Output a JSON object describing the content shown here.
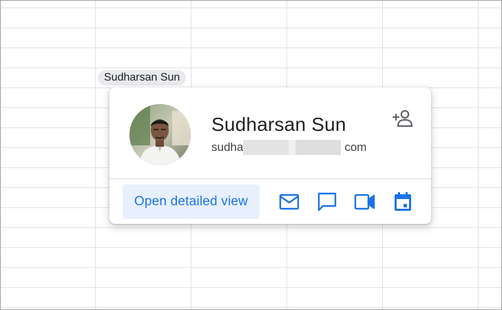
{
  "chip": {
    "label": "Sudharsan Sun"
  },
  "card": {
    "name": "Sudharsan Sun",
    "email_prefix": "sudha",
    "email_suffix": "com",
    "open_detailed_view_label": "Open detailed view"
  },
  "icons": {
    "add_person": "person-add-icon",
    "email": "mail-icon",
    "chat": "chat-icon",
    "video": "video-call-icon",
    "calendar": "calendar-icon"
  },
  "colors": {
    "accent": "#1a73e8",
    "button_bg": "#e8f0fe",
    "chip_bg": "#e8eaed",
    "gridline": "#e1e1e1",
    "text_primary": "#202124"
  }
}
